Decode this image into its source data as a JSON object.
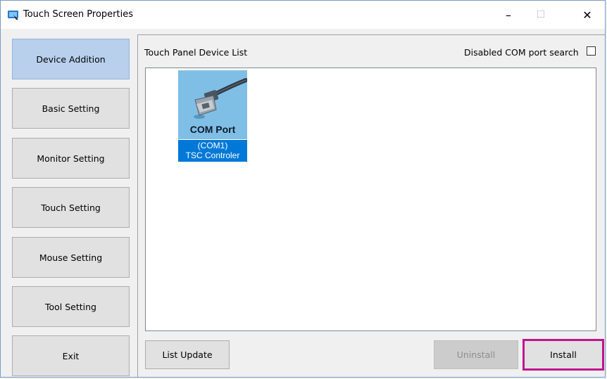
{
  "window": {
    "title": "Touch Screen Properties",
    "minimize_glyph": "–",
    "maximize_glyph": "☐",
    "close_glyph": "✕"
  },
  "sidebar": {
    "items": [
      {
        "label": "Device Addition",
        "active": true
      },
      {
        "label": "Basic Setting",
        "active": false
      },
      {
        "label": "Monitor Setting",
        "active": false
      },
      {
        "label": "Touch Setting",
        "active": false
      },
      {
        "label": "Mouse Setting",
        "active": false
      },
      {
        "label": "Tool Setting",
        "active": false
      },
      {
        "label": "Exit",
        "active": false
      }
    ]
  },
  "main": {
    "title": "Touch Panel Device List",
    "com_search_label": "Disabled COM port search",
    "com_search_checked": false,
    "devices": [
      {
        "icon": "com-port-connector-icon",
        "tile_label": "COM Port",
        "caption_line1": "(COM1)",
        "caption_line2": "TSC Controler",
        "selected": true
      }
    ],
    "buttons": {
      "list_update": "List Update",
      "uninstall": "Uninstall",
      "install": "Install"
    }
  },
  "colors": {
    "active_sidebar": "#b8d0ec",
    "selection": "#0078d7",
    "highlight_border": "#c0148c",
    "tile_background": "#7fbfe6"
  }
}
